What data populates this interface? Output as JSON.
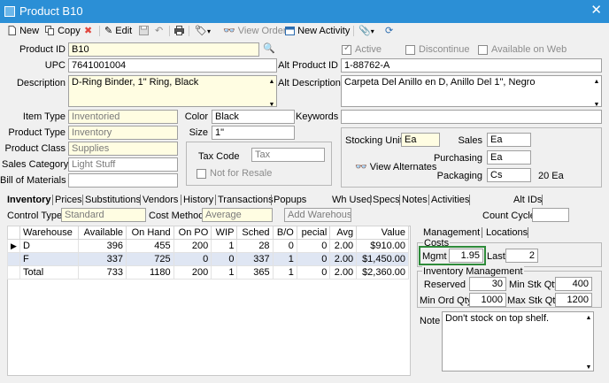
{
  "window": {
    "title": "Product B10"
  },
  "toolbar": {
    "new_label": "New",
    "copy_label": "Copy",
    "edit_label": "Edit",
    "view_order_label": "View Order",
    "new_activity_label": "New Activity"
  },
  "header": {
    "product_id_label": "Product ID",
    "product_id": "B10",
    "active_label": "Active",
    "discontinue_label": "Discontinue",
    "available_on_web_label": "Available on Web",
    "upc_label": "UPC",
    "upc": "7641001004",
    "alt_product_id_label": "Alt Product ID",
    "alt_product_id": "1-88762-A",
    "description_label": "Description",
    "description": "D-Ring Binder, 1\" Ring, Black",
    "alt_description_label": "Alt Description",
    "alt_description": "Carpeta Del Anillo en D, Anillo Del 1\", Negro"
  },
  "attributes": {
    "item_type_label": "Item Type",
    "item_type": "Inventoried",
    "product_type_label": "Product Type",
    "product_type": "Inventory",
    "product_class_label": "Product Class",
    "product_class": "Supplies",
    "sales_category_label": "Sales Category",
    "sales_category": "Light Stuff",
    "bill_of_materials_label": "Bill of Materials",
    "bill_of_materials": "",
    "color_label": "Color",
    "color": "Black",
    "size_label": "Size",
    "size": "1\"",
    "keywords_label": "Keywords",
    "keywords": "",
    "tax_code_label": "Tax Code",
    "tax_code": "Tax",
    "not_for_resale_label": "Not for Resale"
  },
  "units": {
    "stocking_unit_label": "Stocking Unit",
    "stocking_unit": "Ea",
    "sales_label": "Sales",
    "sales": "Ea",
    "purchasing_label": "Purchasing",
    "purchasing": "Ea",
    "packaging_label": "Packaging",
    "packaging": "Cs",
    "packaging_qty": "20 Ea",
    "view_alternates_label": "View Alternates"
  },
  "tabs": [
    "Inventory",
    "Prices",
    "Substitutions",
    "Vendors",
    "History",
    "Transactions",
    "Popups",
    "Wh Used",
    "Specs",
    "Notes",
    "Activities",
    "Alt IDs"
  ],
  "inventory": {
    "control_type_label": "Control Type",
    "control_type": "Standard",
    "cost_method_label": "Cost Method",
    "cost_method": "Average",
    "add_warehouse_label": "Add Warehouse",
    "count_cycle_label": "Count Cycle",
    "count_cycle": "",
    "columns": [
      "Warehouse",
      "Available",
      "On Hand",
      "On PO",
      "WIP",
      "Sched",
      "B/O",
      "pecial",
      "Avg",
      "Value"
    ],
    "rows": [
      [
        "D",
        "396",
        "455",
        "200",
        "1",
        "28",
        "0",
        "0",
        "2.00",
        "$910.00"
      ],
      [
        "F",
        "337",
        "725",
        "0",
        "0",
        "337",
        "1",
        "0",
        "2.00",
        "$1,450.00"
      ],
      [
        "Total",
        "733",
        "1180",
        "200",
        "1",
        "365",
        "1",
        "0",
        "2.00",
        "$2,360.00"
      ]
    ]
  },
  "side_panel": {
    "management_tab": "Management",
    "locations_tab": "Locations",
    "costs_label": "Costs",
    "mgmt_label": "Mgmt",
    "mgmt_value": "1.95",
    "last_label": "Last",
    "last_value": "2",
    "inventory_management_label": "Inventory Management",
    "reserved_label": "Reserved",
    "reserved_value": "30",
    "min_stk_qty_label": "Min Stk Qty",
    "min_stk_qty_value": "400",
    "min_ord_qty_label": "Min Ord Qty",
    "min_ord_qty_value": "1000",
    "max_stk_qty_label": "Max Stk Qty",
    "max_stk_qty_value": "1200",
    "note_label": "Note",
    "note_value": "Don't stock on top shelf."
  },
  "colors": {
    "titlebar": "#2b8fd6",
    "required_field": "#fffde2",
    "selected_row": "#dfe6f3",
    "highlight_box": "#2e8b3a"
  }
}
